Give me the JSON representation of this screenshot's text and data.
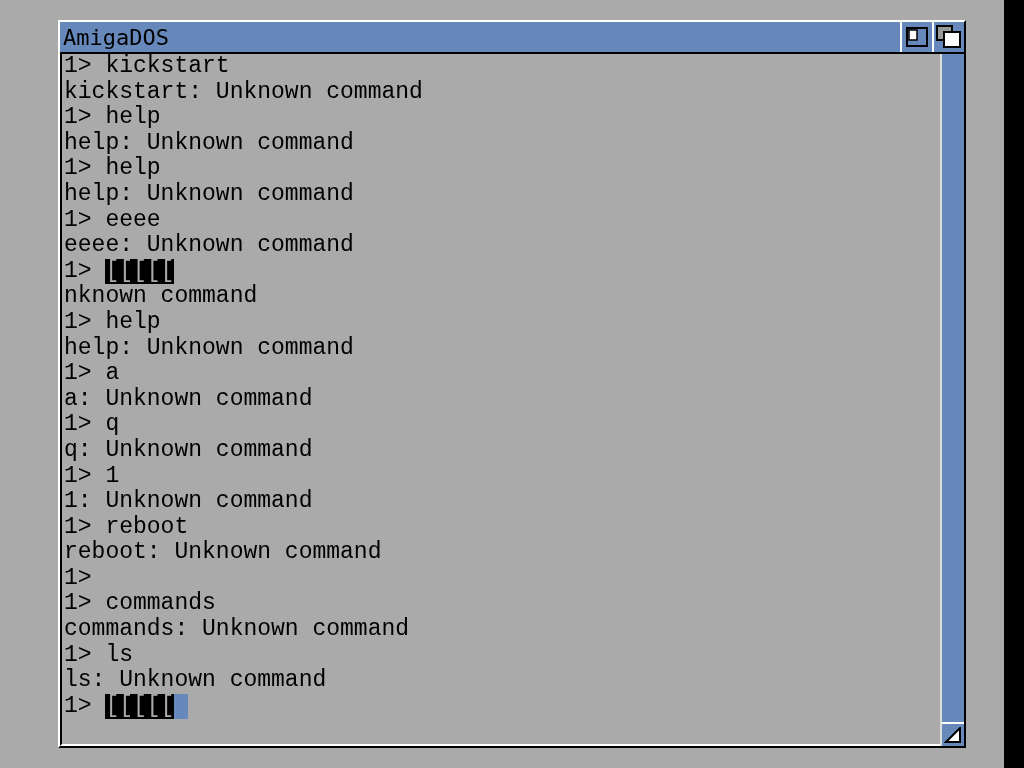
{
  "window": {
    "title": "AmigaDOS"
  },
  "lines": [
    {
      "kind": "input",
      "prompt": "1>",
      "text": "kickstart",
      "inverse": false,
      "cursor": false
    },
    {
      "kind": "output",
      "text": "kickstart: Unknown command"
    },
    {
      "kind": "input",
      "prompt": "1>",
      "text": "help",
      "inverse": false,
      "cursor": false
    },
    {
      "kind": "output",
      "text": "help: Unknown command"
    },
    {
      "kind": "input",
      "prompt": "1>",
      "text": "help",
      "inverse": false,
      "cursor": false
    },
    {
      "kind": "output",
      "text": "help: Unknown command"
    },
    {
      "kind": "input",
      "prompt": "1>",
      "text": "eeee",
      "inverse": false,
      "cursor": false
    },
    {
      "kind": "output",
      "text": "eeee: Unknown command"
    },
    {
      "kind": "input",
      "prompt": "1>",
      "text": "[[[[[",
      "inverse": true,
      "cursor": false
    },
    {
      "kind": "output",
      "text": "nknown command"
    },
    {
      "kind": "input",
      "prompt": "1>",
      "text": "help",
      "inverse": false,
      "cursor": false
    },
    {
      "kind": "output",
      "text": "help: Unknown command"
    },
    {
      "kind": "input",
      "prompt": "1>",
      "text": "a",
      "inverse": false,
      "cursor": false
    },
    {
      "kind": "output",
      "text": "a: Unknown command"
    },
    {
      "kind": "input",
      "prompt": "1>",
      "text": "q",
      "inverse": false,
      "cursor": false
    },
    {
      "kind": "output",
      "text": "q: Unknown command"
    },
    {
      "kind": "input",
      "prompt": "1>",
      "text": "1",
      "inverse": false,
      "cursor": false
    },
    {
      "kind": "output",
      "text": "1: Unknown command"
    },
    {
      "kind": "input",
      "prompt": "1>",
      "text": "reboot",
      "inverse": false,
      "cursor": false
    },
    {
      "kind": "output",
      "text": "reboot: Unknown command"
    },
    {
      "kind": "input",
      "prompt": "1>"
    },
    {
      "kind": "input",
      "prompt": "1>",
      "text": "commands",
      "inverse": false,
      "cursor": false
    },
    {
      "kind": "output",
      "text": "commands: Unknown command"
    },
    {
      "kind": "input",
      "prompt": "1>",
      "text": "ls",
      "inverse": false,
      "cursor": false
    },
    {
      "kind": "output",
      "text": "ls: Unknown command"
    },
    {
      "kind": "input",
      "prompt": "1>",
      "text": "[[[[[",
      "inverse": true,
      "cursor": true
    }
  ]
}
